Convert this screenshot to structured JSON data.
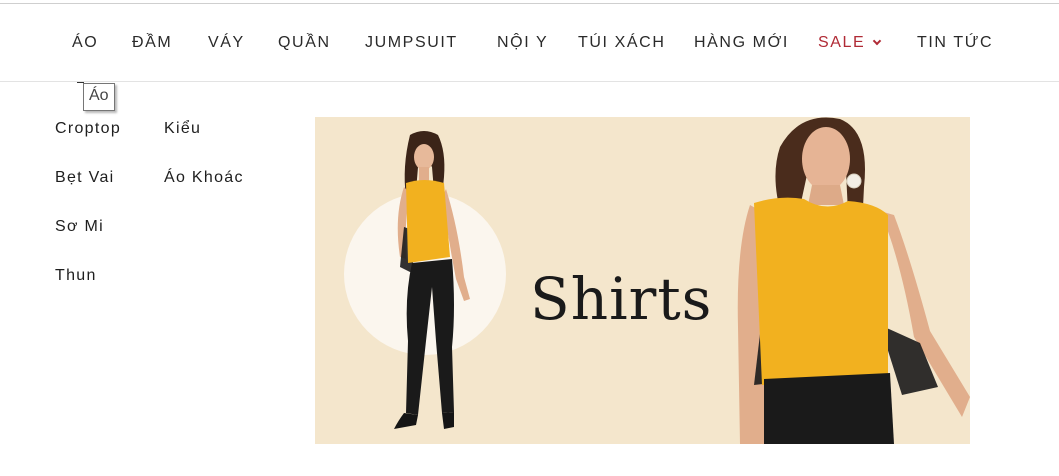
{
  "nav": {
    "items": [
      {
        "label": "ÁO"
      },
      {
        "label": "ĐẦM"
      },
      {
        "label": "VÁY"
      },
      {
        "label": "QUẦN"
      },
      {
        "label": "JUMPSUIT"
      },
      {
        "label": "NỘI Y"
      },
      {
        "label": "TÚI XÁCH"
      },
      {
        "label": "HÀNG MỚI"
      },
      {
        "label": "SALE"
      },
      {
        "label": "TIN TỨC"
      }
    ],
    "sale_color": "#b02a35"
  },
  "tooltip": {
    "text": "Áo"
  },
  "submenu": {
    "col1": [
      "Croptop",
      "Bẹt Vai",
      "Sơ Mi",
      "Thun"
    ],
    "col2": [
      "Kiểu",
      "Áo Khoác"
    ]
  },
  "banner": {
    "title": "Shirts",
    "background": "#f4e6cc",
    "top_color": "#f2b11f",
    "pants_color": "#1a1a1a"
  }
}
